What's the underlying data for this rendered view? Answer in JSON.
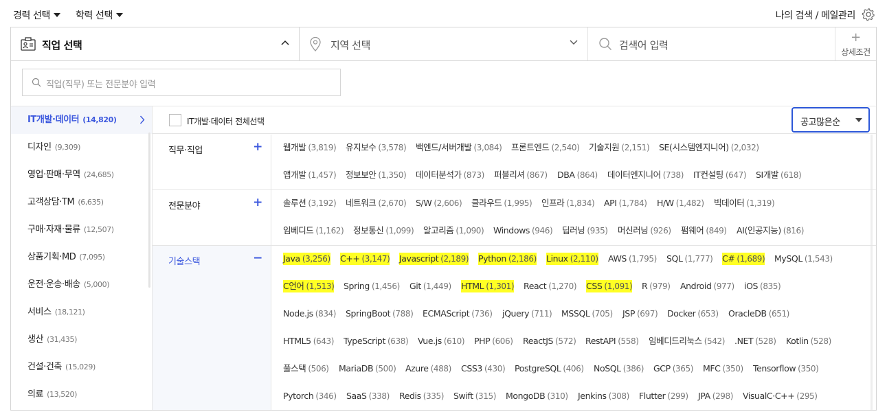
{
  "top": {
    "career_label": "경력 선택",
    "edu_label": "학력 선택",
    "my_menu": "나의 검색 / 메일관리"
  },
  "search": {
    "job_label": "직업 선택",
    "location_label": "지역 선택",
    "keyword_label": "검색어 입력",
    "advanced_plus": "+",
    "advanced_label": "상세조건",
    "job_search_placeholder": "직업(직무) 또는 전문분야 입력"
  },
  "categories": [
    {
      "label": "IT개발·데이터",
      "count": "(14,820)",
      "active": true
    },
    {
      "label": "디자인",
      "count": "(9,309)"
    },
    {
      "label": "영업·판매·무역",
      "count": "(24,685)"
    },
    {
      "label": "고객상담·TM",
      "count": "(6,635)"
    },
    {
      "label": "구매·자재·물류",
      "count": "(12,507)"
    },
    {
      "label": "상품기획·MD",
      "count": "(7,095)"
    },
    {
      "label": "운전·운송·배송",
      "count": "(5,000)"
    },
    {
      "label": "서비스",
      "count": "(18,121)"
    },
    {
      "label": "생산",
      "count": "(31,435)"
    },
    {
      "label": "건설·건축",
      "count": "(15,029)"
    },
    {
      "label": "의료",
      "count": "(13,520)"
    }
  ],
  "subhead": {
    "select_all_label": "IT개발·데이터 전체선택",
    "sort_label": "공고많은순",
    "highlight_color": "#ffff24",
    "accent_color": "#3d59de"
  },
  "groups": [
    {
      "name": "직무·직업",
      "toggle": "+",
      "rows": [
        [
          [
            "웹개발",
            "(3,819)"
          ],
          [
            "유지보수",
            "(3,578)"
          ],
          [
            "백엔드/서버개발",
            "(3,084)"
          ],
          [
            "프론트엔드",
            "(2,540)"
          ],
          [
            "기술지원",
            "(2,151)"
          ],
          [
            "SE(시스템엔지니어)",
            "(2,032)"
          ]
        ],
        [
          [
            "앱개발",
            "(1,457)"
          ],
          [
            "정보보안",
            "(1,350)"
          ],
          [
            "데이터분석가",
            "(873)"
          ],
          [
            "퍼블리셔",
            "(867)"
          ],
          [
            "DBA",
            "(864)"
          ],
          [
            "데이터엔지니어",
            "(738)"
          ],
          [
            "IT컨설팅",
            "(647)"
          ],
          [
            "SI개발",
            "(618)"
          ]
        ]
      ]
    },
    {
      "name": "전문분야",
      "toggle": "+",
      "rows": [
        [
          [
            "솔루션",
            "(3,192)"
          ],
          [
            "네트워크",
            "(2,670)"
          ],
          [
            "S/W",
            "(2,606)"
          ],
          [
            "클라우드",
            "(1,995)"
          ],
          [
            "인프라",
            "(1,834)"
          ],
          [
            "API",
            "(1,784)"
          ],
          [
            "H/W",
            "(1,482)"
          ],
          [
            "빅데이터",
            "(1,319)"
          ]
        ],
        [
          [
            "임베디드",
            "(1,162)"
          ],
          [
            "정보통신",
            "(1,099)"
          ],
          [
            "알고리즘",
            "(1,090)"
          ],
          [
            "Windows",
            "(946)"
          ],
          [
            "딥러닝",
            "(935)"
          ],
          [
            "머신러닝",
            "(926)"
          ],
          [
            "펌웨어",
            "(849)"
          ],
          [
            "AI(인공지능)",
            "(816)"
          ]
        ]
      ]
    },
    {
      "name": "기술스택",
      "toggle": "−",
      "active": true,
      "rows": [
        [
          [
            "Java",
            "(3,256)",
            1
          ],
          [
            "C++",
            "(3,147)",
            1
          ],
          [
            "Javascript",
            "(2,189)",
            1
          ],
          [
            "Python",
            "(2,186)",
            1
          ],
          [
            "Linux",
            "(2,110)",
            1
          ],
          [
            "AWS",
            "(1,795)"
          ],
          [
            "SQL",
            "(1,777)"
          ],
          [
            "C#",
            "(1,689)",
            1
          ],
          [
            "MySQL",
            "(1,543)"
          ]
        ],
        [
          [
            "C언어",
            "(1,513)",
            1
          ],
          [
            "Spring",
            "(1,456)"
          ],
          [
            "Git",
            "(1,449)"
          ],
          [
            "HTML",
            "(1,301)",
            1
          ],
          [
            "React",
            "(1,270)"
          ],
          [
            "CSS",
            "(1,091)",
            1
          ],
          [
            "R",
            "(979)"
          ],
          [
            "Android",
            "(977)"
          ],
          [
            "iOS",
            "(835)"
          ]
        ],
        [
          [
            "Node.js",
            "(834)"
          ],
          [
            "SpringBoot",
            "(788)"
          ],
          [
            "ECMAScript",
            "(736)"
          ],
          [
            "jQuery",
            "(711)"
          ],
          [
            "MSSQL",
            "(705)"
          ],
          [
            "JSP",
            "(697)"
          ],
          [
            "Docker",
            "(653)"
          ],
          [
            "OracleDB",
            "(651)"
          ]
        ],
        [
          [
            "HTML5",
            "(643)"
          ],
          [
            "TypeScript",
            "(638)"
          ],
          [
            "Vue.js",
            "(610)"
          ],
          [
            "PHP",
            "(606)"
          ],
          [
            "ReactJS",
            "(572)"
          ],
          [
            "RestAPI",
            "(558)"
          ],
          [
            "임베디드리눅스",
            "(542)"
          ],
          [
            ".NET",
            "(528)"
          ],
          [
            "Kotlin",
            "(528)"
          ]
        ],
        [
          [
            "풀스택",
            "(506)"
          ],
          [
            "MariaDB",
            "(500)"
          ],
          [
            "Azure",
            "(488)"
          ],
          [
            "CSS3",
            "(430)"
          ],
          [
            "PostgreSQL",
            "(406)"
          ],
          [
            "NoSQL",
            "(386)"
          ],
          [
            "GCP",
            "(365)"
          ],
          [
            "MFC",
            "(350)"
          ],
          [
            "Tensorflow",
            "(350)"
          ]
        ],
        [
          [
            "Pytorch",
            "(346)"
          ],
          [
            "SaaS",
            "(338)"
          ],
          [
            "Redis",
            "(335)"
          ],
          [
            "Swift",
            "(315)"
          ],
          [
            "MongoDB",
            "(310)"
          ],
          [
            "Jenkins",
            "(308)"
          ],
          [
            "Flutter",
            "(299)"
          ],
          [
            "JPA",
            "(298)"
          ],
          [
            "VisualC·C++",
            "(295)"
          ]
        ]
      ]
    }
  ]
}
